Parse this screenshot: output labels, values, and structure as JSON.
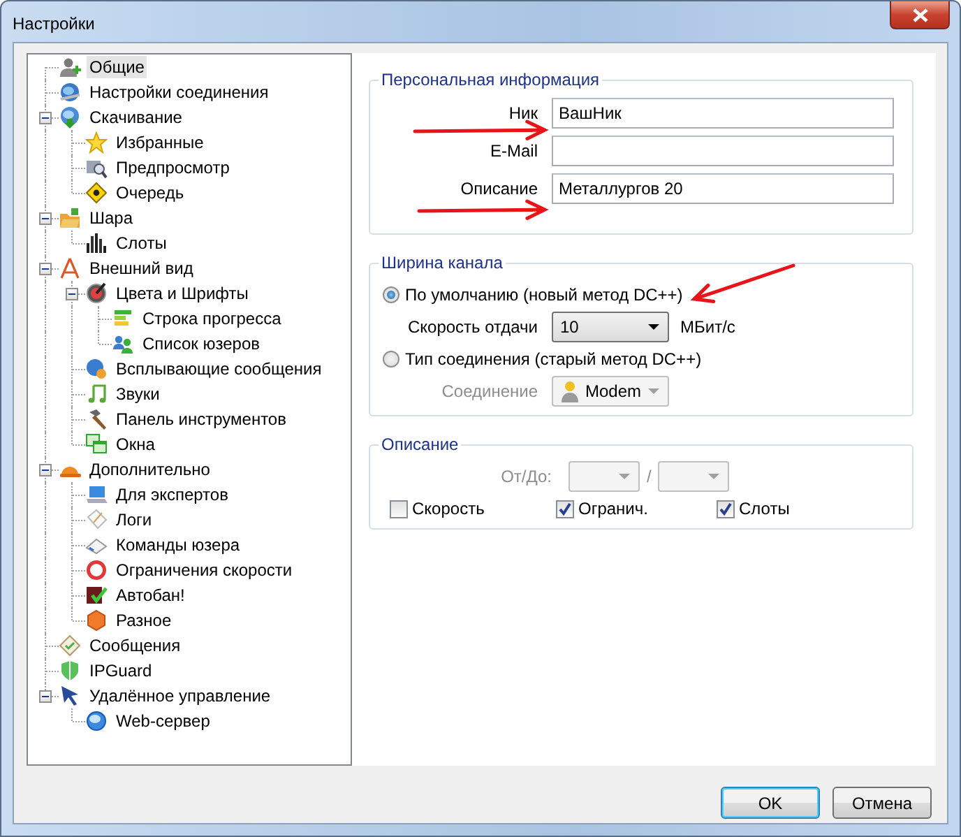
{
  "window": {
    "title": "Настройки"
  },
  "tree": [
    {
      "label": "Общие",
      "selected": true
    },
    {
      "label": "Настройки соединения",
      "selected": false
    },
    {
      "label": "Скачивание",
      "selected": false,
      "expanded": true,
      "children": [
        {
          "label": "Избранные",
          "selected": false
        },
        {
          "label": "Предпросмотр",
          "selected": false
        },
        {
          "label": "Очередь",
          "selected": false
        }
      ]
    },
    {
      "label": "Шара",
      "selected": false,
      "expanded": true,
      "children": [
        {
          "label": "Слоты",
          "selected": false
        }
      ]
    },
    {
      "label": "Внешний вид",
      "selected": false,
      "expanded": true,
      "children": [
        {
          "label": "Цвета и Шрифты",
          "selected": false,
          "expanded": true,
          "children": [
            {
              "label": "Строка прогресса",
              "selected": false
            },
            {
              "label": "Список юзеров",
              "selected": false
            }
          ]
        },
        {
          "label": "Всплывающие сообщения",
          "selected": false
        },
        {
          "label": "Звуки",
          "selected": false
        },
        {
          "label": "Панель инструментов",
          "selected": false
        },
        {
          "label": "Окна",
          "selected": false
        }
      ]
    },
    {
      "label": "Дополнительно",
      "selected": false,
      "expanded": true,
      "children": [
        {
          "label": "Для экспертов",
          "selected": false
        },
        {
          "label": "Логи",
          "selected": false
        },
        {
          "label": "Команды юзера",
          "selected": false
        },
        {
          "label": "Ограничения скорости",
          "selected": false
        },
        {
          "label": "Автобан!",
          "selected": false
        },
        {
          "label": "Разное",
          "selected": false
        }
      ]
    },
    {
      "label": "Сообщения",
      "selected": false
    },
    {
      "label": "IPGuard",
      "selected": false
    },
    {
      "label": "Удалённое управление",
      "selected": false,
      "expanded": true,
      "children": [
        {
          "label": "Web-сервер",
          "selected": false
        }
      ]
    }
  ],
  "personal": {
    "title": "Персональная информация",
    "fields": [
      {
        "label": "Ник",
        "value": "ВашНик"
      },
      {
        "label": "E-Mail"
      },
      {
        "label": "Описание",
        "value": "Металлургов 20"
      }
    ]
  },
  "bandwidth": {
    "title": "Ширина канала",
    "options": [
      {
        "label": "По умолчанию (новый метод DC++)",
        "selected": true
      },
      {
        "label": "Тип соединения (старый метод DC++)",
        "selected": false
      }
    ],
    "speed": {
      "label": "Скорость отдачи",
      "value": "10",
      "unit": "МБит/с",
      "disabled": false
    },
    "connection": {
      "label": "Соединение",
      "value": "Modem",
      "disabled": true
    }
  },
  "description": {
    "title": "Описание",
    "range_label": "От/До:",
    "separator": "/",
    "disabled": true,
    "checkboxes": [
      {
        "label": "Скорость",
        "checked": false
      },
      {
        "label": "Огранич.",
        "checked": true
      },
      {
        "label": "Слоты",
        "checked": true
      }
    ]
  },
  "buttons": [
    {
      "label": "OK",
      "default": true
    },
    {
      "label": "Отмена",
      "default": false
    }
  ]
}
